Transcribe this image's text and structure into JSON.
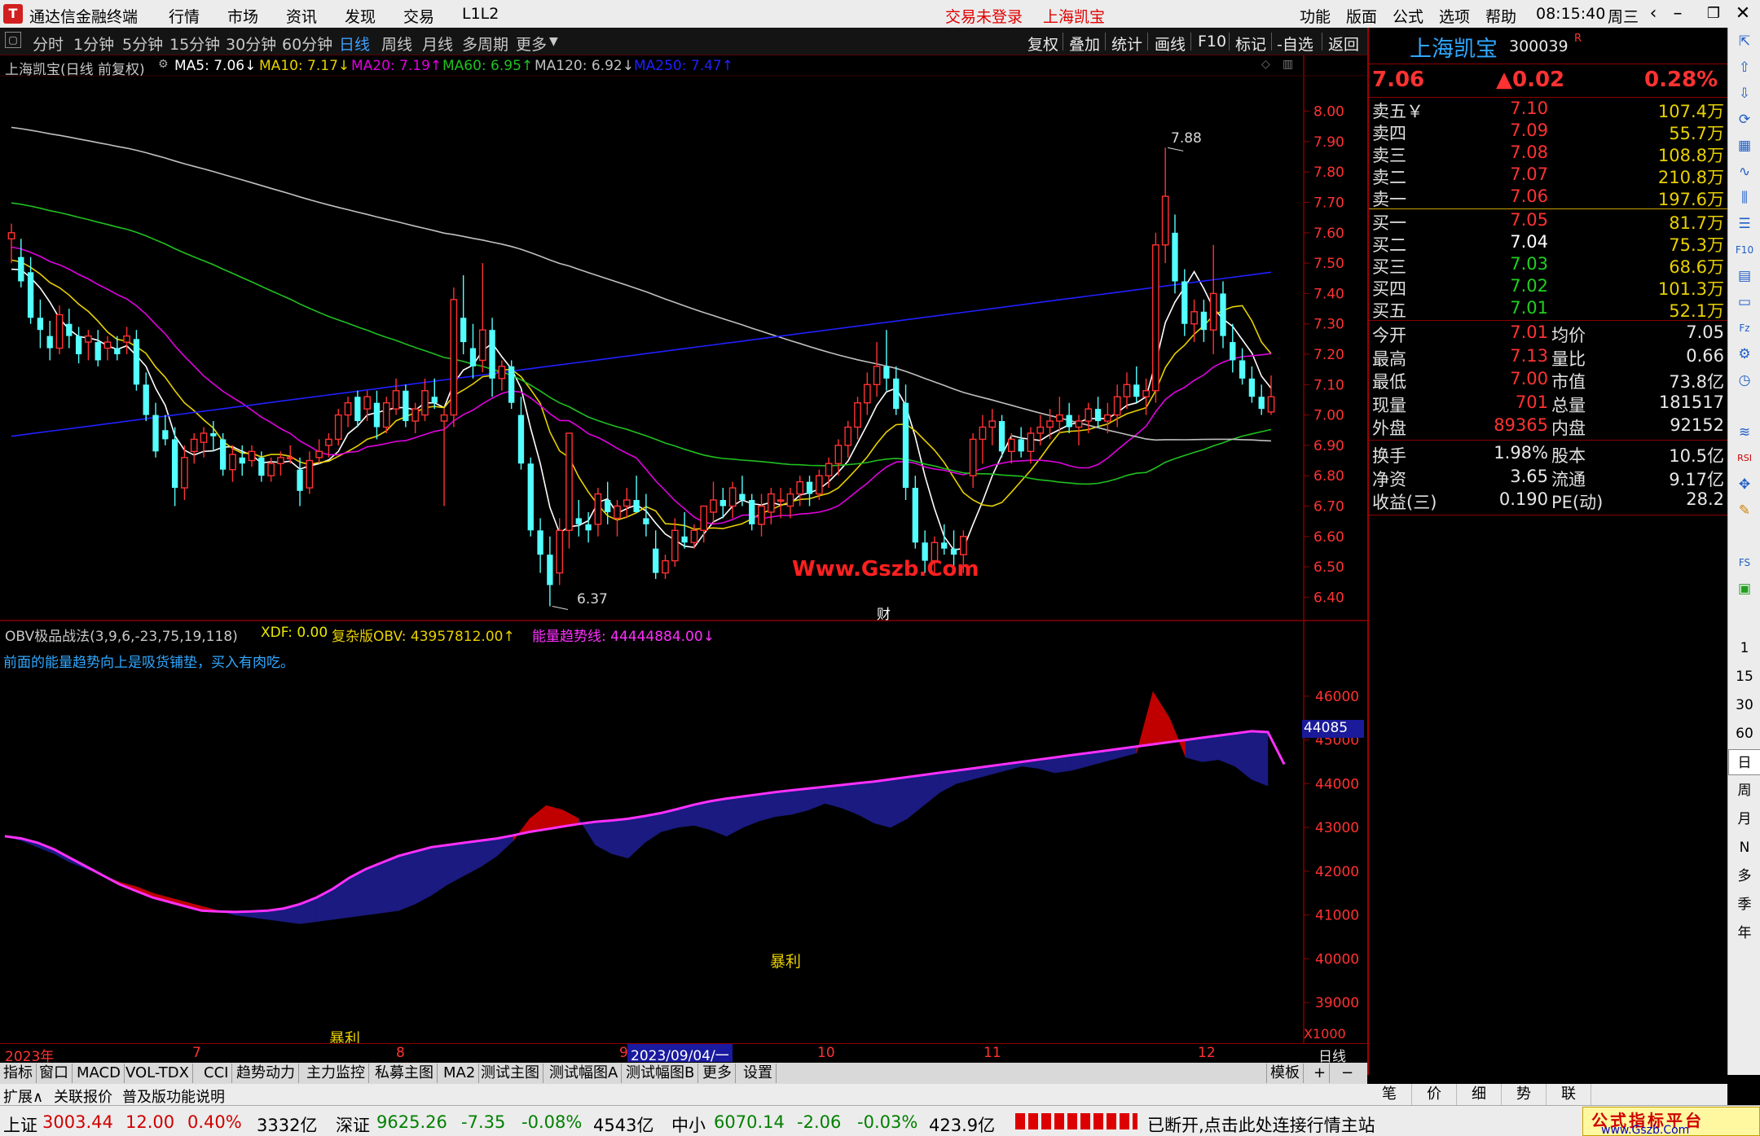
{
  "app": {
    "logo_char": "T",
    "title": "通达信金融终端",
    "menus": [
      "行情",
      "市场",
      "资讯",
      "发现",
      "交易",
      "L1L2"
    ],
    "login_status": "交易未登录",
    "stock_short": "上海凯宝",
    "right_menus": [
      "功能",
      "版面",
      "公式",
      "选项",
      "帮助"
    ],
    "time": "08:15:40",
    "weekday": "周三"
  },
  "periods": [
    "分时",
    "1分钟",
    "5分钟",
    "15分钟",
    "30分钟",
    "60分钟",
    "日线",
    "周线",
    "月线",
    "多周期",
    "更多"
  ],
  "active_period": "日线",
  "tools": [
    "复权",
    "叠加",
    "统计",
    "画线",
    "F10",
    "标记",
    "-自选",
    "返回"
  ],
  "main_header": {
    "title": "上海凯宝(日线 前复权)",
    "ma5": "MA5: 7.06↓",
    "ma10": "MA10: 7.17↓",
    "ma20": "MA20: 7.19↑",
    "ma60": "MA60: 6.95↑",
    "ma120": "MA120: 6.92↓",
    "ma250": "MA250: 7.47↑"
  },
  "sub_header": {
    "title": "OBV极品战法(3,9,6,-23,75,19,118)",
    "xdf": "XDF: 0.00",
    "obv": "复杂版OBV: 43957812.00↑",
    "trend": "能量趋势线: 44444884.00↓",
    "note": "前面的能量趋势向上是吸货铺垫，买入有肉吃。"
  },
  "chart_data": [
    {
      "type": "candlestick",
      "price_axis": [
        "8.00",
        "7.90",
        "7.80",
        "7.70",
        "7.60",
        "7.50",
        "7.40",
        "7.30",
        "7.20",
        "7.10",
        "7.00",
        "6.90",
        "6.80",
        "6.70",
        "6.60",
        "6.50",
        "6.40"
      ],
      "ylim": [
        6.35,
        8.05
      ],
      "annotations": {
        "high": "7.88",
        "low": "6.37",
        "event": "财"
      },
      "ohlc": [
        [
          7.58,
          7.63,
          7.5,
          7.6
        ],
        [
          7.52,
          7.58,
          7.42,
          7.44
        ],
        [
          7.47,
          7.52,
          7.3,
          7.32
        ],
        [
          7.32,
          7.38,
          7.22,
          7.28
        ],
        [
          7.26,
          7.31,
          7.18,
          7.22
        ],
        [
          7.22,
          7.36,
          7.2,
          7.33
        ],
        [
          7.3,
          7.35,
          7.22,
          7.26
        ],
        [
          7.26,
          7.29,
          7.17,
          7.2
        ],
        [
          7.24,
          7.28,
          7.18,
          7.26
        ],
        [
          7.24,
          7.28,
          7.16,
          7.18
        ],
        [
          7.22,
          7.26,
          7.18,
          7.24
        ],
        [
          7.22,
          7.26,
          7.18,
          7.2
        ],
        [
          7.24,
          7.29,
          7.2,
          7.26
        ],
        [
          7.25,
          7.28,
          7.08,
          7.1
        ],
        [
          7.1,
          7.14,
          6.98,
          7.0
        ],
        [
          7.0,
          7.04,
          6.86,
          6.88
        ],
        [
          6.95,
          7.0,
          6.9,
          6.92
        ],
        [
          6.92,
          6.96,
          6.7,
          6.76
        ],
        [
          6.76,
          6.9,
          6.72,
          6.86
        ],
        [
          6.88,
          6.94,
          6.84,
          6.92
        ],
        [
          6.91,
          6.96,
          6.86,
          6.94
        ],
        [
          6.94,
          6.98,
          6.88,
          6.93
        ],
        [
          6.92,
          6.94,
          6.8,
          6.82
        ],
        [
          6.82,
          6.9,
          6.78,
          6.87
        ],
        [
          6.86,
          6.9,
          6.8,
          6.84
        ],
        [
          6.85,
          6.9,
          6.83,
          6.88
        ],
        [
          6.86,
          6.88,
          6.78,
          6.8
        ],
        [
          6.8,
          6.86,
          6.78,
          6.84
        ],
        [
          6.84,
          6.88,
          6.8,
          6.86
        ],
        [
          6.86,
          6.9,
          6.84,
          6.86
        ],
        [
          6.82,
          6.86,
          6.7,
          6.75
        ],
        [
          6.76,
          6.88,
          6.74,
          6.85
        ],
        [
          6.86,
          6.92,
          6.84,
          6.88
        ],
        [
          6.9,
          6.94,
          6.86,
          6.92
        ],
        [
          6.92,
          7.02,
          6.9,
          7.0
        ],
        [
          7.0,
          7.06,
          6.96,
          7.04
        ],
        [
          7.06,
          7.08,
          6.96,
          6.98
        ],
        [
          7.02,
          7.08,
          6.98,
          7.06
        ],
        [
          7.04,
          7.08,
          6.92,
          6.96
        ],
        [
          6.96,
          7.06,
          6.94,
          7.04
        ],
        [
          7.02,
          7.12,
          7.0,
          7.08
        ],
        [
          7.08,
          7.1,
          6.96,
          6.98
        ],
        [
          6.98,
          7.04,
          6.94,
          7.02
        ],
        [
          7.0,
          7.12,
          6.98,
          7.08
        ],
        [
          7.06,
          7.12,
          7.02,
          7.04
        ],
        [
          6.98,
          7.02,
          6.7,
          7.0
        ],
        [
          7.0,
          7.42,
          6.96,
          7.38
        ],
        [
          7.32,
          7.46,
          7.2,
          7.24
        ],
        [
          7.22,
          7.3,
          7.12,
          7.16
        ],
        [
          7.18,
          7.5,
          7.14,
          7.28
        ],
        [
          7.28,
          7.32,
          7.06,
          7.12
        ],
        [
          7.12,
          7.18,
          7.08,
          7.16
        ],
        [
          7.16,
          7.18,
          7.02,
          7.04
        ],
        [
          7.0,
          7.06,
          6.82,
          6.84
        ],
        [
          6.84,
          6.86,
          6.6,
          6.62
        ],
        [
          6.62,
          6.66,
          6.48,
          6.54
        ],
        [
          6.54,
          6.6,
          6.37,
          6.44
        ],
        [
          6.48,
          6.66,
          6.44,
          6.62
        ],
        [
          6.62,
          6.94,
          6.56,
          6.94
        ],
        [
          6.66,
          6.72,
          6.6,
          6.64
        ],
        [
          6.64,
          6.68,
          6.58,
          6.62
        ],
        [
          6.64,
          6.76,
          6.6,
          6.74
        ],
        [
          6.72,
          6.78,
          6.64,
          6.68
        ],
        [
          6.66,
          6.72,
          6.6,
          6.7
        ],
        [
          6.7,
          6.76,
          6.66,
          6.72
        ],
        [
          6.72,
          6.8,
          6.68,
          6.68
        ],
        [
          6.66,
          6.74,
          6.6,
          6.64
        ],
        [
          6.56,
          6.62,
          6.46,
          6.48
        ],
        [
          6.48,
          6.54,
          6.46,
          6.52
        ],
        [
          6.52,
          6.66,
          6.5,
          6.62
        ],
        [
          6.6,
          6.68,
          6.56,
          6.58
        ],
        [
          6.58,
          6.64,
          6.56,
          6.62
        ],
        [
          6.62,
          6.7,
          6.58,
          6.7
        ],
        [
          6.68,
          6.78,
          6.64,
          6.72
        ],
        [
          6.72,
          6.76,
          6.66,
          6.7
        ],
        [
          6.7,
          6.78,
          6.66,
          6.76
        ],
        [
          6.74,
          6.8,
          6.7,
          6.72
        ],
        [
          6.72,
          6.74,
          6.62,
          6.64
        ],
        [
          6.64,
          6.74,
          6.6,
          6.7
        ],
        [
          6.68,
          6.76,
          6.64,
          6.74
        ],
        [
          6.72,
          6.76,
          6.66,
          6.72
        ],
        [
          6.7,
          6.76,
          6.66,
          6.74
        ],
        [
          6.74,
          6.8,
          6.7,
          6.78
        ],
        [
          6.78,
          6.8,
          6.7,
          6.74
        ],
        [
          6.74,
          6.82,
          6.72,
          6.8
        ],
        [
          6.8,
          6.86,
          6.76,
          6.84
        ],
        [
          6.84,
          6.92,
          6.8,
          6.9
        ],
        [
          6.9,
          6.98,
          6.86,
          6.96
        ],
        [
          6.96,
          7.06,
          6.92,
          7.04
        ],
        [
          7.04,
          7.14,
          7.0,
          7.1
        ],
        [
          7.1,
          7.24,
          7.06,
          7.16
        ],
        [
          7.16,
          7.28,
          7.08,
          7.12
        ],
        [
          7.12,
          7.16,
          7.0,
          7.02
        ],
        [
          7.04,
          7.1,
          6.72,
          6.76
        ],
        [
          6.76,
          6.8,
          6.56,
          6.58
        ],
        [
          6.58,
          6.62,
          6.48,
          6.52
        ],
        [
          6.52,
          6.6,
          6.48,
          6.58
        ],
        [
          6.58,
          6.64,
          6.54,
          6.56
        ],
        [
          6.56,
          6.62,
          6.5,
          6.54
        ],
        [
          6.54,
          6.62,
          6.48,
          6.6
        ],
        [
          6.8,
          6.94,
          6.76,
          6.92
        ],
        [
          6.92,
          7.0,
          6.84,
          6.96
        ],
        [
          6.96,
          7.02,
          6.9,
          6.98
        ],
        [
          6.98,
          7.0,
          6.86,
          6.88
        ],
        [
          6.88,
          6.94,
          6.84,
          6.92
        ],
        [
          6.92,
          6.96,
          6.86,
          6.88
        ],
        [
          6.88,
          6.96,
          6.84,
          6.94
        ],
        [
          6.94,
          7.0,
          6.9,
          6.96
        ],
        [
          6.96,
          7.02,
          6.92,
          6.98
        ],
        [
          6.98,
          7.06,
          6.94,
          7.0
        ],
        [
          7.0,
          7.04,
          6.94,
          6.96
        ],
        [
          6.96,
          7.0,
          6.9,
          6.98
        ],
        [
          6.98,
          7.04,
          6.94,
          7.02
        ],
        [
          7.02,
          7.06,
          6.96,
          6.98
        ],
        [
          6.98,
          7.04,
          6.94,
          7.0
        ],
        [
          7.0,
          7.1,
          6.96,
          7.06
        ],
        [
          7.06,
          7.14,
          7.02,
          7.1
        ],
        [
          7.1,
          7.16,
          7.04,
          7.06
        ],
        [
          7.06,
          7.12,
          7.0,
          7.08
        ],
        [
          7.08,
          7.6,
          7.04,
          7.56
        ],
        [
          7.56,
          7.88,
          7.5,
          7.72
        ],
        [
          7.6,
          7.66,
          7.4,
          7.44
        ],
        [
          7.44,
          7.48,
          7.26,
          7.3
        ],
        [
          7.3,
          7.38,
          7.24,
          7.34
        ],
        [
          7.34,
          7.38,
          7.24,
          7.28
        ],
        [
          7.28,
          7.56,
          7.2,
          7.4
        ],
        [
          7.4,
          7.44,
          7.22,
          7.26
        ],
        [
          7.24,
          7.3,
          7.14,
          7.18
        ],
        [
          7.18,
          7.22,
          7.1,
          7.12
        ],
        [
          7.12,
          7.16,
          7.04,
          7.06
        ],
        [
          7.06,
          7.1,
          7.0,
          7.02
        ],
        [
          7.01,
          7.13,
          7.0,
          7.06
        ]
      ]
    },
    {
      "type": "area",
      "y_axis": [
        "46000",
        "45000",
        "44000",
        "43000",
        "42000",
        "41000",
        "40000",
        "39000"
      ],
      "ylim": [
        38500,
        46500
      ],
      "current_label": "44085",
      "unit": "X1000",
      "annotations": [
        "暴利",
        "暴利"
      ],
      "obv": [
        42800,
        42700,
        42550,
        42400,
        42200,
        42050,
        41900,
        41750,
        41650,
        41500,
        41400,
        41300,
        41200,
        41100,
        41000,
        40950,
        40900,
        40850,
        40800,
        40850,
        40900,
        40950,
        41000,
        41050,
        41100,
        41250,
        41450,
        41700,
        41900,
        42100,
        42350,
        42700,
        43200,
        43500,
        43400,
        43200,
        42600,
        42400,
        42300,
        42650,
        42900,
        43000,
        43050,
        42950,
        42800,
        43000,
        43150,
        43250,
        43300,
        43400,
        43550,
        43450,
        43300,
        43100,
        43000,
        43200,
        43500,
        43800,
        44000,
        44100,
        44200,
        44300,
        44400,
        44350,
        44250,
        44300,
        44400,
        44500,
        44600,
        44700,
        46100,
        45500,
        44600,
        44500,
        44550,
        44400,
        44100,
        43950
      ],
      "trend": [
        42800,
        42750,
        42650,
        42500,
        42300,
        42100,
        41900,
        41700,
        41550,
        41400,
        41300,
        41200,
        41100,
        41080,
        41070,
        41080,
        41100,
        41150,
        41250,
        41400,
        41600,
        41850,
        42050,
        42200,
        42350,
        42450,
        42550,
        42600,
        42650,
        42700,
        42750,
        42820,
        42900,
        42960,
        43020,
        43080,
        43130,
        43160,
        43200,
        43260,
        43330,
        43420,
        43520,
        43600,
        43660,
        43710,
        43760,
        43810,
        43850,
        43890,
        43930,
        43970,
        44010,
        44050,
        44100,
        44150,
        44200,
        44250,
        44300,
        44350,
        44400,
        44450,
        44500,
        44550,
        44600,
        44650,
        44700,
        44750,
        44800,
        44850,
        44900,
        44950,
        45000,
        45050,
        45100,
        45150,
        45200,
        45180,
        44444
      ]
    }
  ],
  "axis_labels": [
    "2023年",
    "7",
    "8",
    "9",
    "2023/09/04/一",
    "10",
    "11",
    "12",
    "日线"
  ],
  "indicator_tabs": [
    "指标",
    "窗口",
    "MACD",
    "VOL-TDX",
    "CCI",
    "趋势动力",
    "主力监控",
    "私募主图",
    "MA2",
    "测试主图",
    "测试幅图A",
    "测试幅图B",
    "更多",
    "设置",
    "模板",
    "+",
    "−"
  ],
  "extra_tabs": [
    "扩展∧",
    "关联报价",
    "普及版功能说明"
  ],
  "quote": {
    "name": "上海凯宝",
    "code": "300039",
    "code_tag": "R",
    "price": "7.06",
    "change": "▲0.02",
    "pct": "0.28%",
    "asks": [
      {
        "label": "卖五￥",
        "price": "7.10",
        "vol": "107.4万"
      },
      {
        "label": "卖四",
        "price": "7.09",
        "vol": "55.7万"
      },
      {
        "label": "卖三",
        "price": "7.08",
        "vol": "108.8万"
      },
      {
        "label": "卖二",
        "price": "7.07",
        "vol": "210.8万"
      },
      {
        "label": "卖一",
        "price": "7.06",
        "vol": "197.6万"
      }
    ],
    "bids": [
      {
        "label": "买一",
        "price": "7.05",
        "vol": "81.7万"
      },
      {
        "label": "买二",
        "price": "7.04",
        "vol": "75.3万"
      },
      {
        "label": "买三",
        "price": "7.03",
        "vol": "68.6万"
      },
      {
        "label": "买四",
        "price": "7.02",
        "vol": "101.3万"
      },
      {
        "label": "买五",
        "price": "7.01",
        "vol": "52.1万"
      }
    ],
    "stats": [
      {
        "l1": "今开",
        "v1": "7.01",
        "l2": "均价",
        "v2": "7.05"
      },
      {
        "l1": "最高",
        "v1": "7.13",
        "l2": "量比",
        "v2": "0.66"
      },
      {
        "l1": "最低",
        "v1": "7.00",
        "l2": "市值",
        "v2": "73.8亿"
      },
      {
        "l1": "现量",
        "v1": "701",
        "l2": "总量",
        "v2": "181517"
      },
      {
        "l1": "外盘",
        "v1": "89365",
        "l2": "内盘",
        "v2": "92152"
      }
    ],
    "stats2": [
      {
        "l1": "换手",
        "v1": "1.98%",
        "l2": "股本",
        "v2": "10.5亿"
      },
      {
        "l1": "净资",
        "v1": "3.65",
        "l2": "流通",
        "v2": "9.17亿"
      },
      {
        "l1": "收益(三)",
        "v1": "0.190",
        "l2": "PE(动)",
        "v2": "28.2"
      }
    ],
    "tabs": [
      "笔",
      "价",
      "细",
      "势",
      "联"
    ]
  },
  "rtool_periods": [
    "1",
    "15",
    "30",
    "60",
    "日",
    "周",
    "月",
    "N",
    "多",
    "季",
    "年"
  ],
  "status": {
    "sh_name": "上证",
    "sh_val": "3003.44",
    "sh_chg": "12.00",
    "sh_pct": "0.40%",
    "sh_amt": "3332亿",
    "sz_name": "深证",
    "sz_val": "9625.26",
    "sz_chg": "-7.35",
    "sz_pct": "-0.08%",
    "sz_amt": "4543亿",
    "zx_name": "中小",
    "zx_val": "6070.14",
    "zx_chg": "-2.06",
    "zx_pct": "-0.03%",
    "zx_amt": "423.9亿",
    "conn": "已断开,点击此处连接行情主站"
  },
  "watermark": {
    "chart": "Www.Gszb.Com",
    "brand": "公式指标平台",
    "brand_url": "www.Gszb.Com"
  },
  "colors": {
    "ma5": "#ffffff",
    "ma10": "#e8d000",
    "ma20": "#e000e0",
    "ma60": "#20c020",
    "ma120": "#c0c0c0",
    "ma250": "#2020ff",
    "up": "#ff3232",
    "down": "#54ffff",
    "obv_up": "#c00000",
    "obv_down": "#1a1a80",
    "trend": "#ff30ff"
  }
}
